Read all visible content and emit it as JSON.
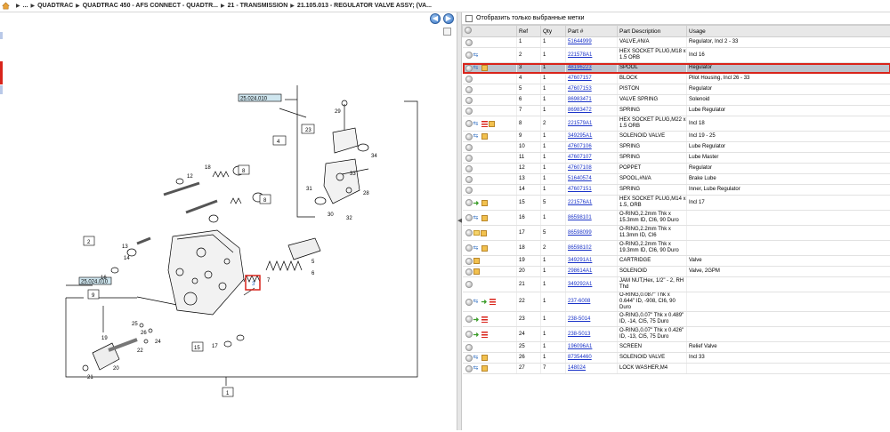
{
  "breadcrumb": {
    "items": [
      "...",
      "QUADTRAC",
      "QUADTRAC 450 - AFS CONNECT - QUADTR...",
      "21 - TRANSMISSION",
      "21.105.013 - REGULATOR VALVE ASSY; (VA..."
    ]
  },
  "diagram": {
    "callouts": [
      "1",
      "2",
      "4",
      "5",
      "6",
      "7",
      "8",
      "8",
      "9",
      "12",
      "13",
      "14",
      "15",
      "16",
      "17",
      "18",
      "19",
      "20",
      "21",
      "22",
      "23",
      "24",
      "25",
      "26",
      "27",
      "28",
      "29",
      "30",
      "31",
      "32",
      "33",
      "34"
    ],
    "ref_boxes": [
      "25.024.010",
      "25.024.010"
    ],
    "highlight_label": "3"
  },
  "filter": {
    "label": "Отобразить только выбранные метки",
    "checked": false
  },
  "table": {
    "columns": [
      "",
      "Ref",
      "Qty",
      "Part #",
      "Part Description",
      "Usage"
    ],
    "rows": [
      {
        "icons": [
          "dot"
        ],
        "ref": "1",
        "qty": "1",
        "part": "51644999",
        "desc": "VALVE,#N/A",
        "usage": "Regulator, Incl 2 - 33"
      },
      {
        "icons": [
          "dot",
          "blue"
        ],
        "ref": "2",
        "qty": "1",
        "part": "221578A1",
        "desc": "HEX SOCKET PLUG,M18 x 1.5 ORB",
        "usage": "Incl 16"
      },
      {
        "icons": [
          "dot",
          "blue",
          "book"
        ],
        "ref": "3",
        "qty": "1",
        "part": "48196223",
        "desc": "SPOOL",
        "usage": "Regulator",
        "selected": true
      },
      {
        "icons": [
          "dot"
        ],
        "ref": "4",
        "qty": "1",
        "part": "47607157",
        "desc": "BLOCK",
        "usage": "Pilot Housing, Incl 26 - 33"
      },
      {
        "icons": [
          "dot"
        ],
        "ref": "5",
        "qty": "1",
        "part": "47607153",
        "desc": "PISTON",
        "usage": "Regulator"
      },
      {
        "icons": [
          "dot"
        ],
        "ref": "6",
        "qty": "1",
        "part": "86983471",
        "desc": "VALVE SPRING",
        "usage": "Solenoid"
      },
      {
        "icons": [
          "dot"
        ],
        "ref": "7",
        "qty": "1",
        "part": "86983472",
        "desc": "SPRING",
        "usage": "Lube Regulator"
      },
      {
        "icons": [
          "dot",
          "blue",
          "red",
          "book"
        ],
        "ref": "8",
        "qty": "2",
        "part": "221579A1",
        "desc": "HEX SOCKET PLUG,M22 x 1.5 ORB",
        "usage": "Incl 18"
      },
      {
        "icons": [
          "dot",
          "blue",
          "book"
        ],
        "ref": "9",
        "qty": "1",
        "part": "349295A1",
        "desc": "SOLENOID VALVE",
        "usage": "Incl 19 - 25"
      },
      {
        "icons": [
          "dot"
        ],
        "ref": "10",
        "qty": "1",
        "part": "47607106",
        "desc": "SPRING",
        "usage": "Lube Regulator"
      },
      {
        "icons": [
          "dot"
        ],
        "ref": "11",
        "qty": "1",
        "part": "47607107",
        "desc": "SPRING",
        "usage": "Lube Master"
      },
      {
        "icons": [
          "dot"
        ],
        "ref": "12",
        "qty": "1",
        "part": "47607108",
        "desc": "POPPET",
        "usage": "Regulator"
      },
      {
        "icons": [
          "dot"
        ],
        "ref": "13",
        "qty": "1",
        "part": "51640574",
        "desc": "SPOOL,#N/A",
        "usage": "Brake Lube"
      },
      {
        "icons": [
          "dot"
        ],
        "ref": "14",
        "qty": "1",
        "part": "47607151",
        "desc": "SPRING",
        "usage": "Inner, Lube Regulator"
      },
      {
        "icons": [
          "dot",
          "green",
          "book"
        ],
        "ref": "15",
        "qty": "5",
        "part": "221576A1",
        "desc": "HEX SOCKET PLUG,M14 x 1.5, ORB",
        "usage": "Incl 17"
      },
      {
        "icons": [
          "dot",
          "blue",
          "book"
        ],
        "ref": "16",
        "qty": "1",
        "part": "86598101",
        "desc": "O-RING,2.2mm Thk x 15.3mm ID, CI6, 90 Duro",
        "usage": ""
      },
      {
        "icons": [
          "dot",
          "note",
          "book"
        ],
        "ref": "17",
        "qty": "5",
        "part": "86598099",
        "desc": "O-RING,2.2mm Thk x 11.3mm ID, CI6",
        "usage": ""
      },
      {
        "icons": [
          "dot",
          "blue",
          "book"
        ],
        "ref": "18",
        "qty": "2",
        "part": "86598102",
        "desc": "O-RING,2.2mm Thk x 19.3mm ID, CI6, 90 Duro",
        "usage": ""
      },
      {
        "icons": [
          "dot",
          "book"
        ],
        "ref": "19",
        "qty": "1",
        "part": "349291A1",
        "desc": "CARTRIDGE",
        "usage": "Valve"
      },
      {
        "icons": [
          "dot",
          "book"
        ],
        "ref": "20",
        "qty": "1",
        "part": "298614A1",
        "desc": "SOLENOID",
        "usage": "Valve, 2GPM"
      },
      {
        "icons": [
          "dot"
        ],
        "ref": "21",
        "qty": "1",
        "part": "349292A1",
        "desc": "JAM NUT,Hex, 1/2\" - 2, RH Thd",
        "usage": ""
      },
      {
        "icons": [
          "dot",
          "blue",
          "green",
          "red"
        ],
        "ref": "22",
        "qty": "1",
        "part": "237-6008",
        "desc": "O-RING,0.087\" Thk x 0.644\" ID, -908, CI6, 90 Duro",
        "usage": ""
      },
      {
        "icons": [
          "dot",
          "green",
          "red"
        ],
        "ref": "23",
        "qty": "1",
        "part": "238-5014",
        "desc": "O-RING,0.07\" Thk x 0.489\" ID, -14, CI5, 75 Duro",
        "usage": ""
      },
      {
        "icons": [
          "dot",
          "green",
          "red"
        ],
        "ref": "24",
        "qty": "1",
        "part": "238-5013",
        "desc": "O-RING,0.07\" Thk x 0.426\" ID, -13, CI5, 75 Duro",
        "usage": ""
      },
      {
        "icons": [
          "dot"
        ],
        "ref": "25",
        "qty": "1",
        "part": "196096A1",
        "desc": "SCREEN",
        "usage": "Relief Valve"
      },
      {
        "icons": [
          "dot",
          "blue",
          "book"
        ],
        "ref": "26",
        "qty": "1",
        "part": "87354460",
        "desc": "SOLENOID VALVE",
        "usage": "Incl 33"
      },
      {
        "icons": [
          "dot",
          "blue",
          "book"
        ],
        "ref": "27",
        "qty": "7",
        "part": "148024",
        "desc": "LOCK WASHER,M4",
        "usage": ""
      }
    ]
  }
}
